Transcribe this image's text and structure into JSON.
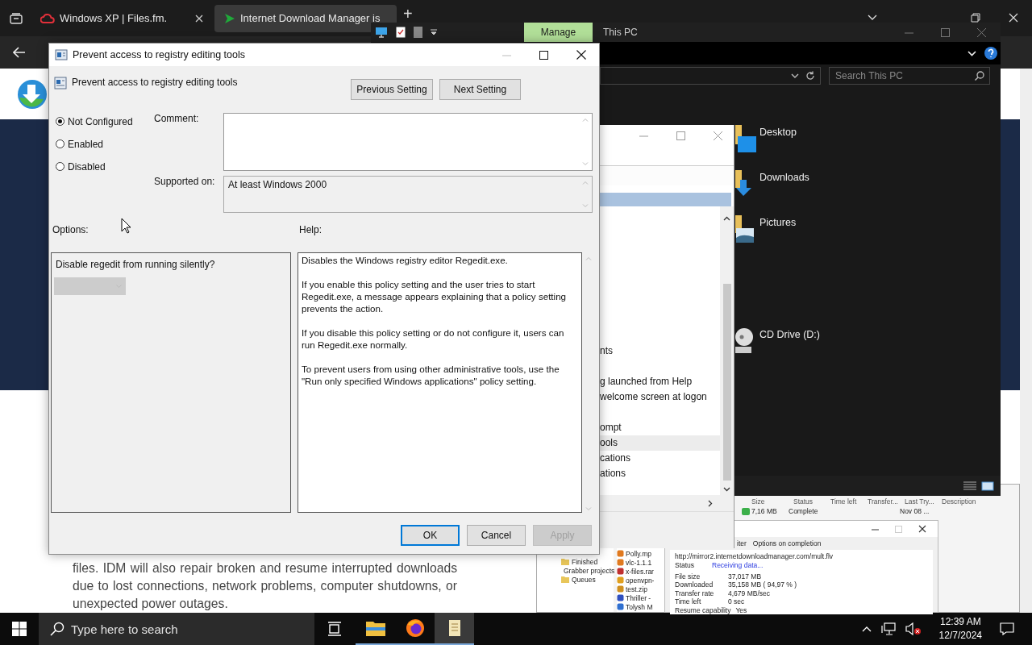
{
  "browser": {
    "tabs": [
      {
        "title": "Windows XP | Files.fm.",
        "selected": false
      },
      {
        "title": "Internet Download Manager is",
        "selected": true
      }
    ],
    "new_tab": "+"
  },
  "webpage": {
    "paragraph": "files. IDM will also repair broken and resume interrupted downloads due to lost connections, network problems, computer shutdowns, or unexpected power outages."
  },
  "idm": {
    "columns": [
      "Size",
      "Status",
      "Time left",
      "Transfer...",
      "Last Try...",
      "Description"
    ],
    "rows": [
      {
        "size": "7,16 MB",
        "status": "Complete",
        "last_try": "Nov 08 ..."
      }
    ],
    "categories": [
      "Finished",
      "Grabber projects",
      "Queues"
    ],
    "files": [
      "Polly.mp",
      "vlc-1.1.1",
      "x-files.rar",
      "openvpn-",
      "test.zip",
      "Thriller -",
      "Tolysh M"
    ]
  },
  "download": {
    "tabs": [
      "iter",
      "Options on completion"
    ],
    "url": "http://mirror2.internetdownloadmanager.com/mult.flv",
    "fields": [
      {
        "label": "Status",
        "value": "Receiving data...",
        "kind": "status"
      },
      {
        "label": "File size",
        "value": "37,017  MB",
        "kind": "plain"
      },
      {
        "label": "Downloaded",
        "value": "35,158  MB  ( 94,97 % )",
        "kind": "plain"
      },
      {
        "label": "Transfer rate",
        "value": "4,679  MB/sec",
        "kind": "plain"
      },
      {
        "label": "Time left",
        "value": "0 sec",
        "kind": "plain"
      },
      {
        "label": "Resume capability",
        "value": "Yes",
        "kind": "plain"
      }
    ]
  },
  "explorer": {
    "ribbon_tab": "Manage",
    "title": "This PC",
    "search_placeholder": "Search This PC",
    "items": [
      {
        "name": "Desktop",
        "kind": "desktop"
      },
      {
        "name": "Downloads",
        "kind": "downloads"
      },
      {
        "name": "Pictures",
        "kind": "pictures"
      },
      {
        "name": "CD Drive (D:)",
        "kind": "cd"
      }
    ]
  },
  "policy_list": {
    "items": [
      {
        "text": "nts",
        "selected": false
      },
      {
        "text": "g launched from Help",
        "selected": false
      },
      {
        "text": "welcome screen at logon",
        "selected": false
      },
      {
        "text": "ompt",
        "selected": false
      },
      {
        "text": "ools",
        "selected": true
      },
      {
        "text": "cations",
        "selected": false
      },
      {
        "text": "ations",
        "selected": false
      }
    ]
  },
  "dialog": {
    "title": "Prevent access to registry editing tools",
    "policy_name": "Prevent access to registry editing tools",
    "nav_buttons": [
      "Previous Setting",
      "Next Setting"
    ],
    "states": [
      {
        "label": "Not Configured",
        "selected": true
      },
      {
        "label": "Enabled",
        "selected": false
      },
      {
        "label": "Disabled",
        "selected": false
      }
    ],
    "comment_label": "Comment:",
    "supported_label": "Supported on:",
    "supported_value": "At least Windows 2000",
    "options_label": "Options:",
    "help_label": "Help:",
    "option_text": "Disable regedit from running silently?",
    "option_dropdown": {
      "disabled": true
    },
    "help": [
      "Disables the Windows registry editor Regedit.exe.",
      "If you enable this policy setting and the user tries to start Regedit.exe, a message appears explaining that a policy setting prevents the action.",
      "If you disable this policy setting or do not configure it, users can run Regedit.exe normally.",
      "To prevent users from using other administrative tools, use the \"Run only specified Windows applications\" policy setting."
    ],
    "buttons": [
      {
        "label": "OK",
        "kind": "default",
        "disabled": false
      },
      {
        "label": "Cancel",
        "kind": "normal",
        "disabled": false
      },
      {
        "label": "Apply",
        "kind": "normal",
        "disabled": true
      }
    ]
  },
  "taskbar": {
    "search_placeholder": "Type here to search",
    "time": "12:39 AM",
    "date": "12/7/2024",
    "apps": [
      {
        "kind": "files",
        "selected": false
      },
      {
        "kind": "firefox",
        "selected": false
      },
      {
        "kind": "notepad",
        "selected": true
      }
    ]
  }
}
